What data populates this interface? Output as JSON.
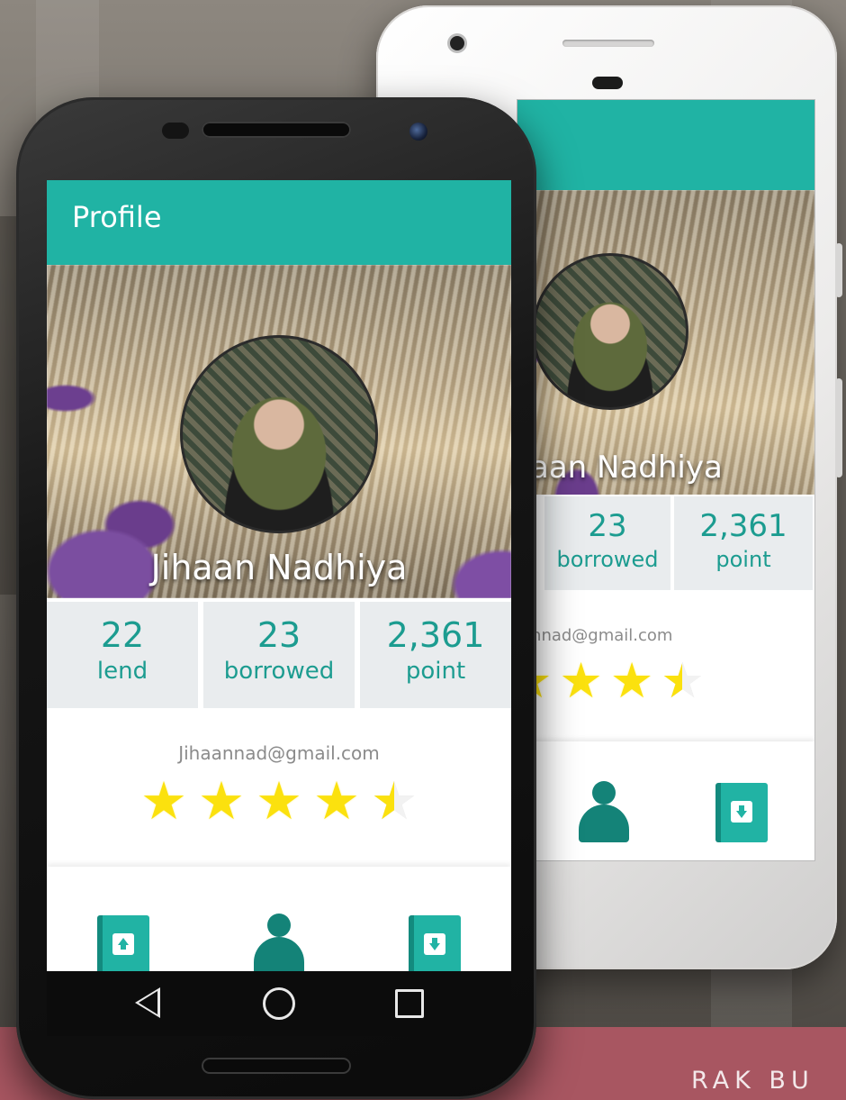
{
  "brand": {
    "text": "RAK BU"
  },
  "app": {
    "title": "Profile",
    "user": {
      "name": "Jihaan Nadhiya",
      "email": "Jihaannad@gmail.com",
      "rating": 4.5,
      "rating_max": 5
    },
    "stats": [
      {
        "value": "22",
        "label": "lend"
      },
      {
        "value": "23",
        "label": "borrowed"
      },
      {
        "value": "2,361",
        "label": "point"
      }
    ]
  },
  "back_phone": {
    "name_partial": "aan Nadhiya",
    "email_partial": "annad@gmail.com",
    "stats": [
      {
        "value": "23",
        "label": "borrowed"
      },
      {
        "value": "2,361",
        "label": "point"
      }
    ]
  },
  "nav_icons": [
    "book-lend-icon",
    "profile-person-icon",
    "book-borrow-icon"
  ],
  "system_nav": [
    "back-icon",
    "home-icon",
    "recents-icon"
  ],
  "colors": {
    "app_bar": "#20b3a4",
    "stat_text": "#1c9c90",
    "star": "#fbe10e",
    "footer_band": "#a85661"
  }
}
